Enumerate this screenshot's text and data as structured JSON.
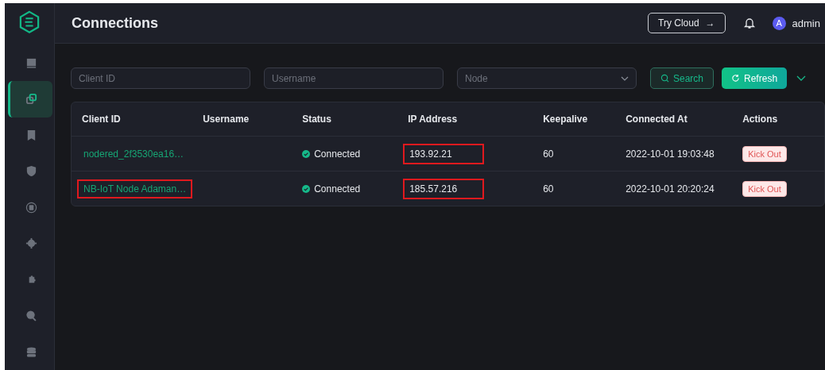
{
  "page_title": "Connections",
  "header": {
    "try_cloud": "Try Cloud",
    "arrow": "→",
    "avatar_letter": "A",
    "user": "admin"
  },
  "sidebar": {
    "items": [
      {
        "selected": false
      },
      {
        "selected": true
      },
      {
        "selected": false
      },
      {
        "selected": false
      },
      {
        "selected": false
      },
      {
        "selected": false
      },
      {
        "selected": false
      },
      {
        "selected": false
      },
      {
        "selected": false
      }
    ]
  },
  "filters": {
    "client_id": {
      "placeholder": "Client ID"
    },
    "username": {
      "placeholder": "Username"
    },
    "node": {
      "placeholder": "Node"
    },
    "search_button": "Search",
    "refresh_button": "Refresh"
  },
  "table": {
    "columns": [
      "Client ID",
      "Username",
      "Status",
      "IP Address",
      "Keepalive",
      "Connected At",
      "Actions"
    ],
    "rows": [
      {
        "client_id": "nodered_2f3530ea16…",
        "client_id_highlighted": false,
        "status": "Connected",
        "ip": "193.92.21",
        "ip_highlighted": true,
        "keepalive": "60",
        "connected_at": "2022-10-01 19:03:48",
        "action": "Kick Out"
      },
      {
        "client_id": "NB-IoT Node Adaman…",
        "client_id_highlighted": true,
        "status": "Connected",
        "ip": "185.57.216",
        "ip_highlighted": true,
        "keepalive": "60",
        "connected_at": "2022-10-01 20:20:24",
        "action": "Kick Out"
      }
    ]
  }
}
